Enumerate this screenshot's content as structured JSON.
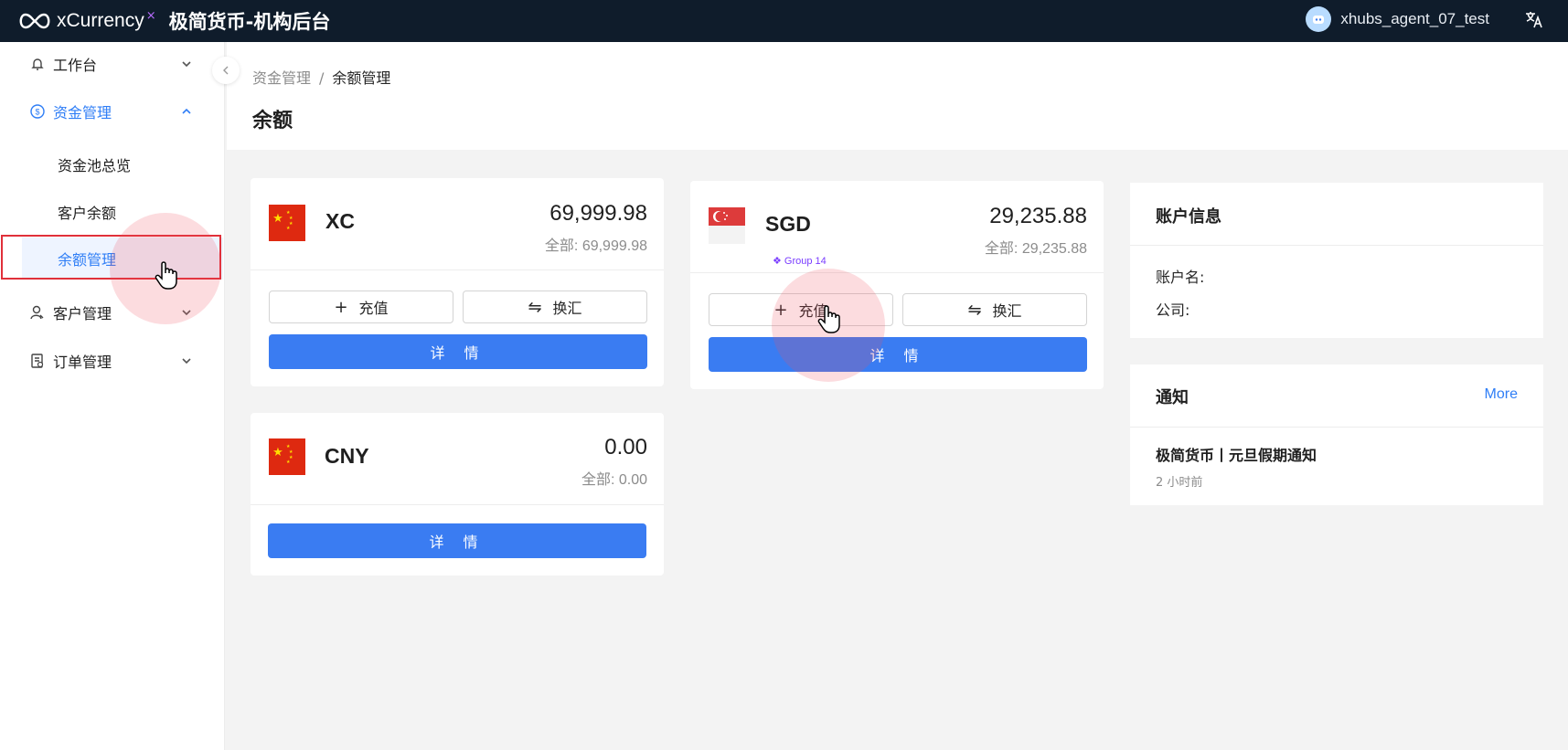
{
  "header": {
    "logo_text": "xCurrency",
    "logo_mark": "×",
    "app_title": "极简货币-机构后台",
    "username": "xhubs_agent_07_test"
  },
  "sidebar": {
    "items": [
      {
        "label": "工作台",
        "icon": "bell-icon"
      },
      {
        "label": "资金管理",
        "icon": "dollar-circle-icon"
      },
      {
        "label": "资金池总览"
      },
      {
        "label": "客户余额"
      },
      {
        "label": "余额管理"
      },
      {
        "label": "客户管理",
        "icon": "user-icon"
      },
      {
        "label": "订单管理",
        "icon": "order-icon"
      }
    ]
  },
  "breadcrumb": {
    "parent": "资金管理",
    "separator": "/",
    "current": "余额管理"
  },
  "page_title": "余额",
  "cards": [
    {
      "code": "XC",
      "amount": "69,999.98",
      "total": "全部: 69,999.98",
      "recharge": "充值",
      "exchange": "换汇",
      "detail": "详 情",
      "flag": "china-flag"
    },
    {
      "code": "SGD",
      "amount": "29,235.88",
      "total": "全部: 29,235.88",
      "recharge": "充值",
      "exchange": "换汇",
      "detail": "详 情",
      "flag": "singapore-flag"
    },
    {
      "code": "CNY",
      "amount": "0.00",
      "total": "全部: 0.00",
      "detail": "详 情",
      "flag": "china-flag"
    }
  ],
  "group_tag": "❖ Group 14",
  "account_info": {
    "title": "账户信息",
    "name_label": "账户名:",
    "company_label": "公司:"
  },
  "notice": {
    "title": "通知",
    "more": "More",
    "item_title": "极简货币丨元旦假期通知",
    "item_time": "2 小时前"
  },
  "colors": {
    "topbar": "#0f1c2b",
    "primary": "#3a7cf2",
    "active": "#2f7ef6",
    "highlight_box": "#e0303a"
  }
}
